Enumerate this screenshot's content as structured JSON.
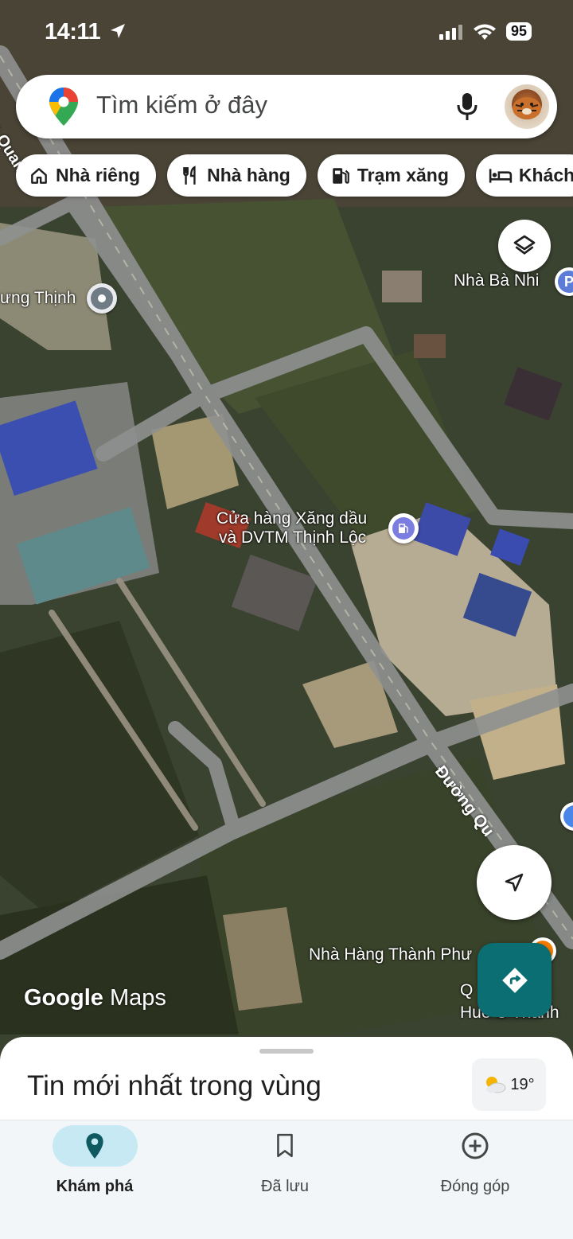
{
  "status_bar": {
    "time": "14:11",
    "battery": "95"
  },
  "search": {
    "placeholder": "Tìm kiếm ở đây"
  },
  "chips": [
    {
      "label": "Nhà riêng",
      "icon": "home-icon"
    },
    {
      "label": "Nhà hàng",
      "icon": "restaurant-icon"
    },
    {
      "label": "Trạm xăng",
      "icon": "gas-station-icon"
    },
    {
      "label": "Khách",
      "icon": "hotel-icon"
    }
  ],
  "map": {
    "labels": {
      "place_1": "ưng Thịnh",
      "place_2": "Nhà Bà Nhi",
      "gas_station_line1": "Cửa hàng Xăng dầu",
      "gas_station_line2": "và DVTM Thịnh Lộc",
      "restaurant": "Nhà Hàng Thành Phư",
      "food_line1": "Q",
      "food_line2": "Huế C Thành",
      "road_top": "g Quan",
      "road_bottom": "Đường Qu"
    },
    "attribution": {
      "google": "Google",
      "maps": "Maps"
    }
  },
  "sheet": {
    "title": "Tin mới nhất trong vùng",
    "weather": "19°"
  },
  "nav": [
    {
      "label": "Khám phá",
      "active": true
    },
    {
      "label": "Đã lưu",
      "active": false
    },
    {
      "label": "Đóng góp",
      "active": false
    }
  ],
  "colors": {
    "accent": "#0b6e73",
    "nav_active_pill": "#c6e9f3",
    "poi_blue": "#7b7ee0",
    "poi_orange": "#f57c00"
  }
}
